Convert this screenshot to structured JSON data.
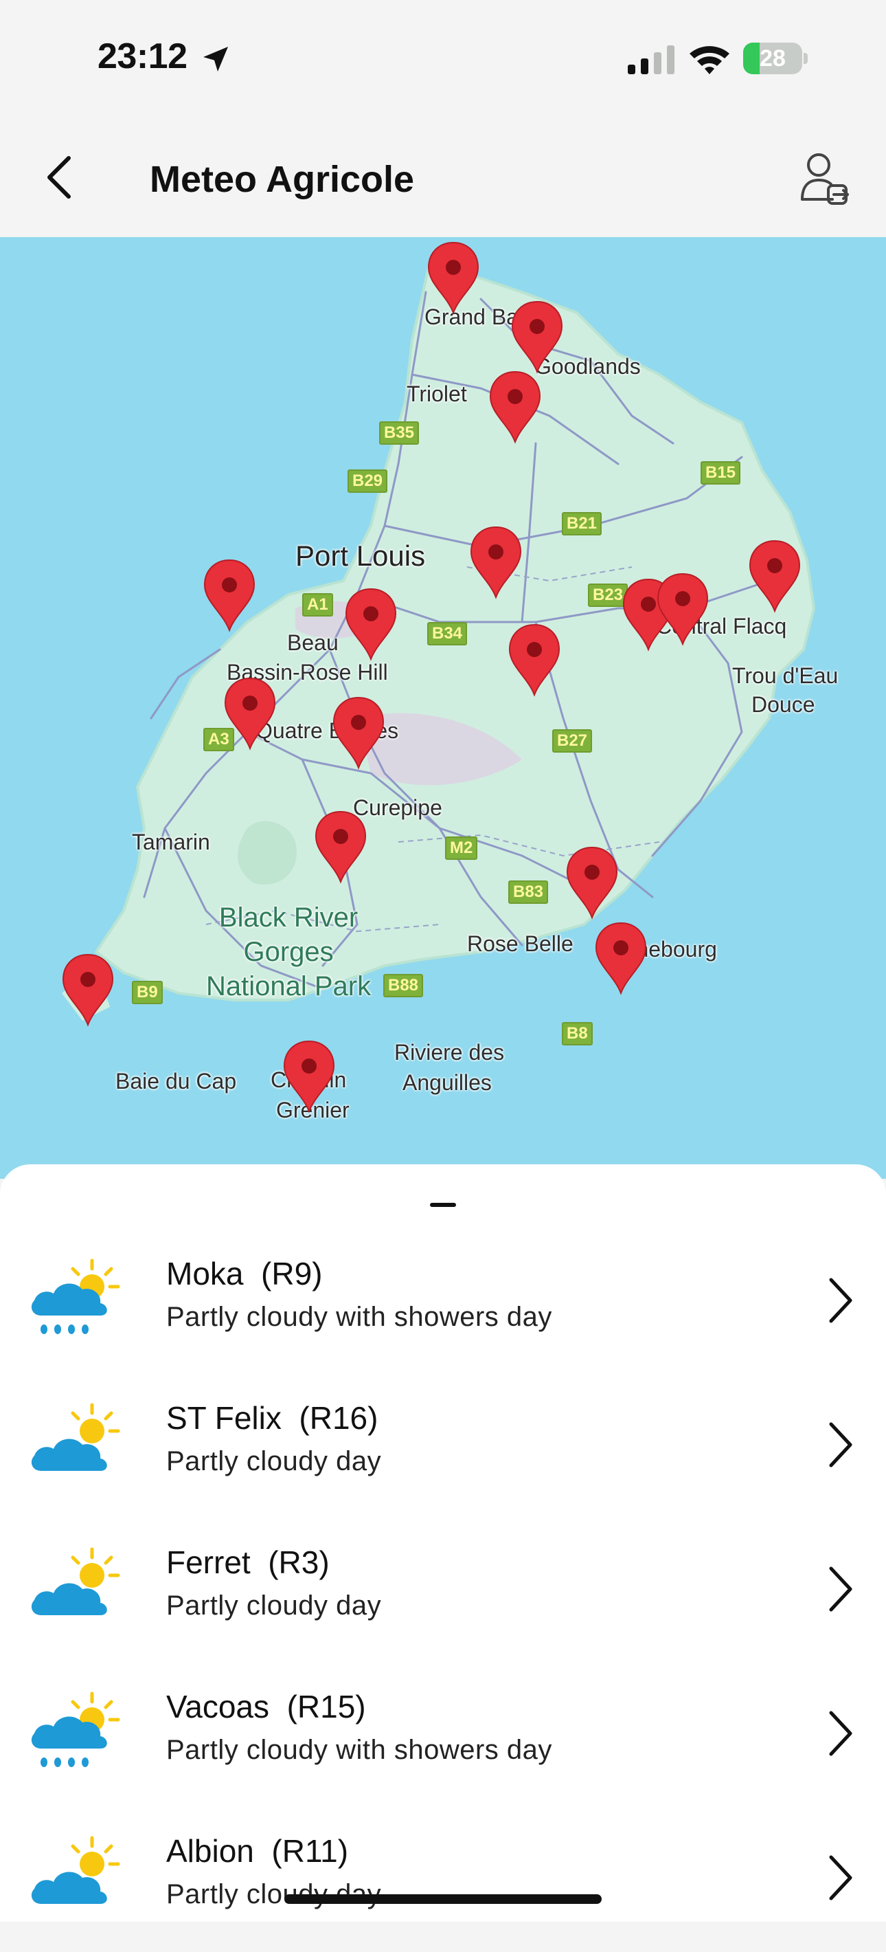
{
  "status_bar": {
    "time": "23:12",
    "battery": "28"
  },
  "header": {
    "title": "Meteo Agricole"
  },
  "map": {
    "labels": {
      "grand_baie": "Grand Baie",
      "goodlands": "Goodlands",
      "triolet": "Triolet",
      "port_louis": "Port Louis",
      "beau_bassin": "Beau",
      "beau_bassin2": "Bassin-Rose Hill",
      "quatre_bornes": "Quatre Bornes",
      "central_flacq": "Central Flacq",
      "trou_deau_douce1": "Trou d'Eau",
      "trou_deau_douce2": "Douce",
      "curepipe": "Curepipe",
      "tamarin": "Tamarin",
      "black_river1": "Black River",
      "black_river2": "Gorges",
      "black_river3": "National Park",
      "rose_belle": "Rose Belle",
      "mahebourg": "Mahebourg",
      "baie_du_cap": "Baie du Cap",
      "chemin_grenier1": "Chemin",
      "chemin_grenier2": "Grenier",
      "riviere1": "Riviere des",
      "riviere2": "Anguilles"
    },
    "roads": [
      "B35",
      "B29",
      "B15",
      "B21",
      "A1",
      "B34",
      "B23",
      "A3",
      "B27",
      "M2",
      "B83",
      "B9",
      "B88",
      "B8"
    ]
  },
  "stations": [
    {
      "name": "Moka  (R9)",
      "condition": "Partly cloudy with showers day",
      "icon": "cloud-sun-rain-icon"
    },
    {
      "name": "ST Felix  (R16)",
      "condition": "Partly cloudy day",
      "icon": "cloud-sun-icon"
    },
    {
      "name": "Ferret  (R3)",
      "condition": "Partly cloudy day",
      "icon": "cloud-sun-icon"
    },
    {
      "name": "Vacoas  (R15)",
      "condition": "Partly cloudy with showers day",
      "icon": "cloud-sun-rain-icon"
    },
    {
      "name": "Albion  (R11)",
      "condition": "Partly cloudy day",
      "icon": "cloud-sun-icon"
    }
  ],
  "colors": {
    "pin": "#e8303a",
    "sea": "#91d9ee",
    "land": "#cfeee0",
    "cloud": "#1e9ad6",
    "sun": "#f7c80f"
  }
}
